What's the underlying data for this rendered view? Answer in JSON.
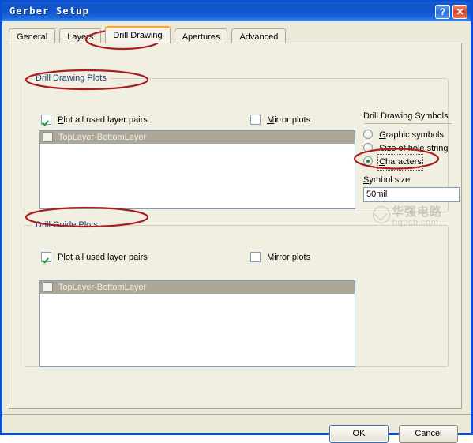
{
  "window": {
    "title": "Gerber Setup",
    "help_button": "?",
    "close_button": "✕",
    "accent_titlebar": "#0f55ce",
    "face_color": "#ece9d8",
    "annotation_color": "#a81f1f"
  },
  "tabs": [
    {
      "label": "General",
      "active": false
    },
    {
      "label": "Layers",
      "active": false
    },
    {
      "label": "Drill Drawing",
      "active": true
    },
    {
      "label": "Apertures",
      "active": false
    },
    {
      "label": "Advanced",
      "active": false
    }
  ],
  "drill_drawing_plots": {
    "group_title": "Drill Drawing Plots",
    "plot_all_checkbox": {
      "label": "Plot all used layer pairs",
      "mnemonic": "P",
      "checked": true
    },
    "mirror_checkbox": {
      "label": "Mirror plots",
      "mnemonic": "M",
      "checked": false
    },
    "layer_pair_list": [
      {
        "label": "TopLayer-BottomLayer",
        "checked": false,
        "selected": true
      }
    ]
  },
  "drill_guide_plots": {
    "group_title": "Drill Guide Plots",
    "plot_all_checkbox": {
      "label": "Plot all used layer pairs",
      "mnemonic": "P",
      "checked": true
    },
    "mirror_checkbox": {
      "label": "Mirror plots",
      "mnemonic": "M",
      "checked": false
    },
    "layer_pair_list": [
      {
        "label": "TopLayer-BottomLayer",
        "checked": false,
        "selected": true
      }
    ]
  },
  "drill_drawing_symbols": {
    "heading": "Drill Drawing Symbols",
    "options": [
      {
        "label": "Graphic symbols",
        "mnemonic": "G",
        "selected": false
      },
      {
        "label": "Size of hole string",
        "mnemonic": "z",
        "selected": false
      },
      {
        "label": "Characters",
        "mnemonic": "C",
        "selected": true,
        "focused": true
      }
    ],
    "symbol_size": {
      "label": "Symbol size",
      "mnemonic": "S",
      "value": "50mil"
    }
  },
  "footer": {
    "ok_label": "OK",
    "cancel_label": "Cancel"
  },
  "watermark": {
    "chinese": "华强电路",
    "latin": "hqpcb.com"
  }
}
